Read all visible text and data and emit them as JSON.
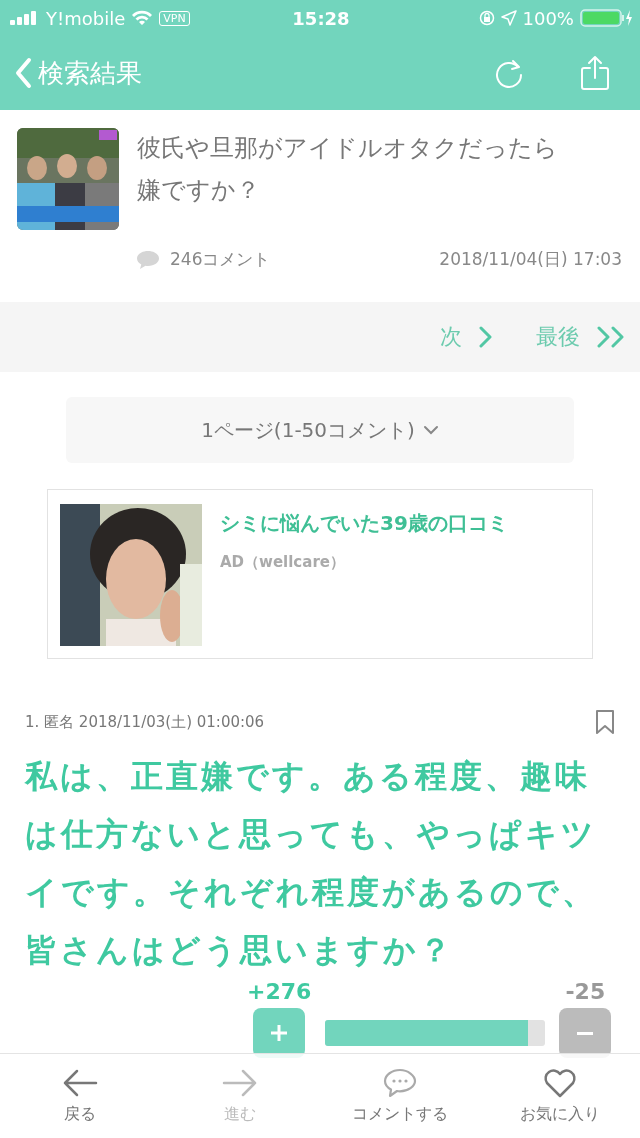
{
  "status_bar": {
    "carrier": "Y!mobile",
    "vpn": "VPN",
    "time": "15:28",
    "battery": "100%"
  },
  "nav_bar": {
    "back_label": "検索結果"
  },
  "topic": {
    "title": "彼氏や旦那がアイドルオタクだったら嫌ですか？",
    "comment_count": "246コメント",
    "date": "2018/11/04(日) 17:03"
  },
  "pager": [
    {
      "label": "次",
      "kind": "next"
    },
    {
      "label": "最後",
      "kind": "last"
    }
  ],
  "page_select": {
    "label": "1ページ(1-50コメント)"
  },
  "ad": {
    "title": "シミに悩んでいた39歳の口コミ",
    "sponsor": "AD（wellcare）"
  },
  "comment": {
    "header": "1. 匿名 2018/11/03(土) 01:00:06",
    "bookmarked": false,
    "body": "私は、正直嫌です。ある程度、趣味は仕方ないと思っても、やっぱキツイです。それぞれ程度があるので、皆さんはどう思いますか？",
    "plus": "+276",
    "minus": "-25",
    "level": 0.92
  },
  "toolbar": [
    {
      "label": "戻る",
      "kind": "back",
      "disabled": false
    },
    {
      "label": "進む",
      "kind": "forward",
      "disabled": true
    },
    {
      "label": "コメントする",
      "kind": "comment",
      "disabled": false
    },
    {
      "label": "お気に入り",
      "kind": "favorite",
      "disabled": false
    }
  ]
}
